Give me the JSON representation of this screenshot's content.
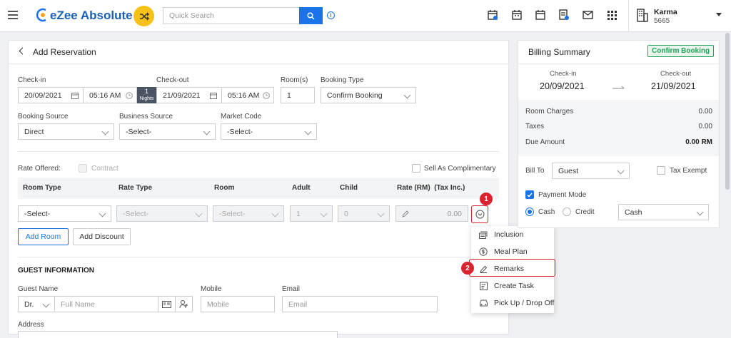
{
  "app": {
    "logo_text": "eZee Absolute",
    "search_placeholder": "Quick Search",
    "property_name": "Karma",
    "property_code": "5665"
  },
  "header": {
    "back_icon": "chevron-left-icon",
    "title": "Add Reservation"
  },
  "form": {
    "checkin_label": "Check-in",
    "checkin_date": "20/09/2021",
    "checkin_time": "05:16 AM",
    "nights_count": "1",
    "nights_label": "Nights",
    "checkout_label": "Check-out",
    "checkout_date": "21/09/2021",
    "checkout_time": "05:16 AM",
    "rooms_label": "Room(s)",
    "rooms_value": "1",
    "booking_type_label": "Booking Type",
    "booking_type_value": "Confirm Booking",
    "booking_source_label": "Booking Source",
    "booking_source_value": "Direct",
    "business_source_label": "Business Source",
    "business_source_value": "-Select-",
    "market_code_label": "Market Code",
    "market_code_value": "-Select-",
    "rate_offered_label": "Rate Offered:",
    "contract_label": "Contract",
    "complimentary_label": "Sell As Complimentary"
  },
  "table": {
    "headers": [
      "Room Type",
      "Rate Type",
      "Room",
      "Adult",
      "Child",
      "Rate (RM)  (Tax Inc.)"
    ],
    "row": {
      "room_type": "-Select-",
      "rate_type": "-Select-",
      "room": "-Select-",
      "adult": "1",
      "child": "0",
      "rate": "0.00"
    }
  },
  "buttons": {
    "add_room": "Add Room",
    "add_discount": "Add Discount"
  },
  "guest": {
    "section_title": "GUEST INFORMATION",
    "name_label": "Guest Name",
    "title_value": "Dr.",
    "name_placeholder": "Full Name",
    "mobile_label": "Mobile",
    "mobile_placeholder": "Mobile",
    "email_label": "Email",
    "email_placeholder": "Email",
    "address_label": "Address"
  },
  "menu": {
    "items": [
      "Inclusion",
      "Meal Plan",
      "Remarks",
      "Create Task",
      "Pick Up / Drop Off"
    ]
  },
  "annotations": {
    "step1": "1",
    "step2": "2"
  },
  "billing": {
    "title": "Billing Summary",
    "status_badge": "Confirm Booking",
    "checkin_label": "Check-in",
    "checkin_date": "20/09/2021",
    "checkout_label": "Check-out",
    "checkout_date": "21/09/2021",
    "room_charges_label": "Room Charges",
    "room_charges_value": "0.00",
    "taxes_label": "Taxes",
    "taxes_value": "0.00",
    "due_amount_label": "Due Amount",
    "due_amount_value": "0.00 RM",
    "bill_to_label": "Bill To",
    "bill_to_value": "Guest",
    "tax_exempt_label": "Tax Exempt",
    "payment_mode_label": "Payment Mode",
    "cash_label": "Cash",
    "credit_label": "Credit",
    "payment_method_value": "Cash"
  },
  "colors": {
    "accent": "#1a73e8",
    "badge_red": "#d9232d",
    "status_green": "#22a25a",
    "shuffle_yellow": "#f6c21a"
  }
}
